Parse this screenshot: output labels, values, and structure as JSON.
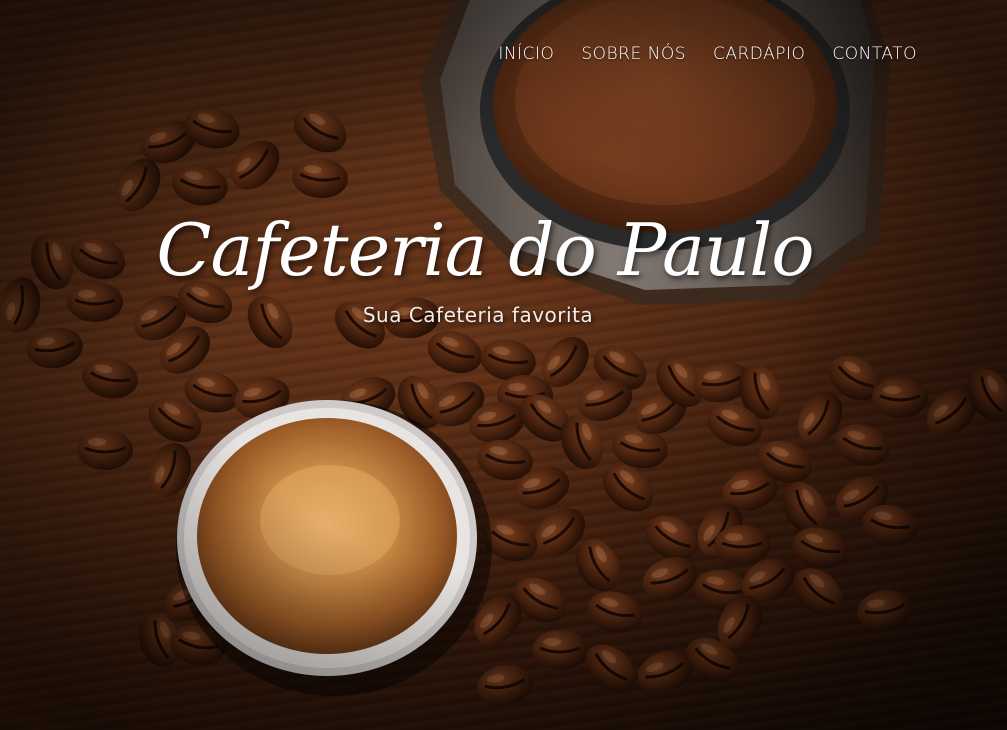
{
  "nav": {
    "items": [
      {
        "label": "INÍCIO"
      },
      {
        "label": "SOBRE NÓS"
      },
      {
        "label": "CARDÁPIO"
      },
      {
        "label": "CONTATO"
      }
    ]
  },
  "hero": {
    "title": "Cafeteria do Paulo",
    "subtitle": "Sua Cafeteria favorita",
    "background_image": "coffee-beans-espresso-cup-grinder-photo"
  },
  "colors": {
    "text": "#ffffff",
    "wood_dark": "#2a160c",
    "wood_mid": "#5a2e16",
    "crema": "#c98a45"
  }
}
